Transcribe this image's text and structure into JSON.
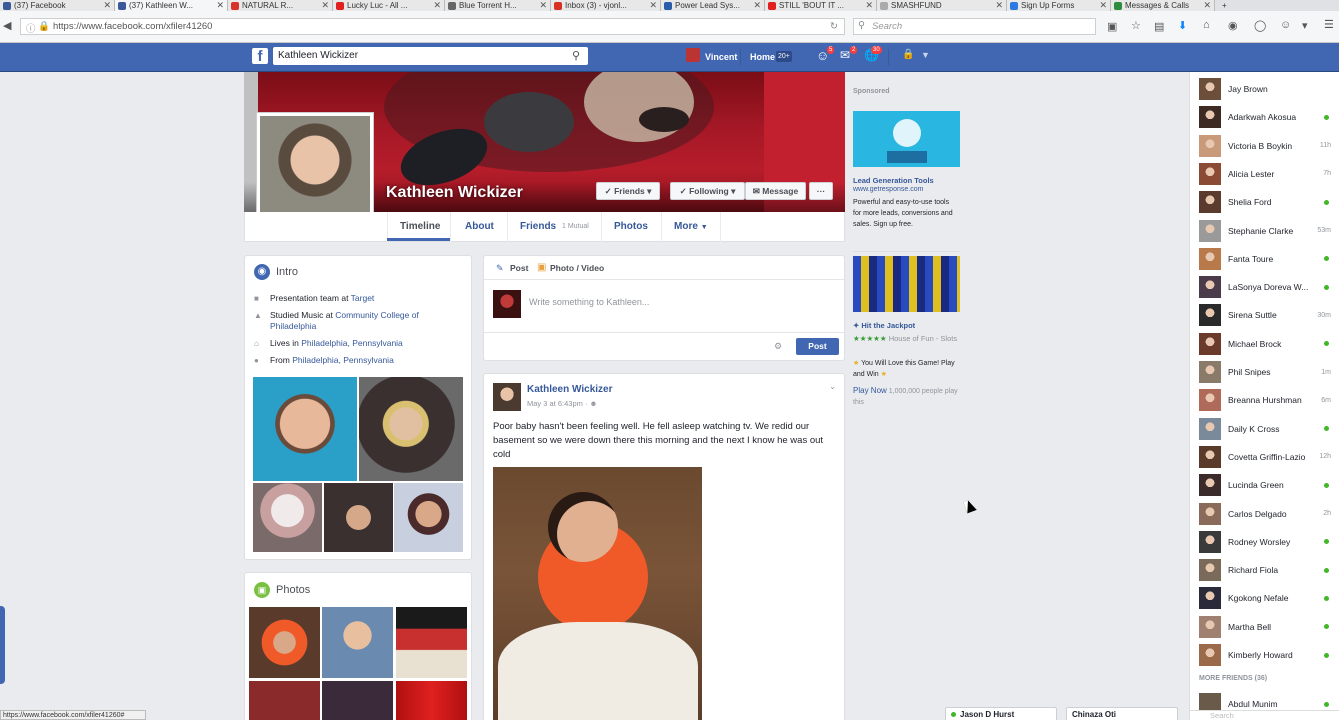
{
  "browser": {
    "tabs": [
      {
        "label": "(37) Facebook",
        "color": "#3b5998",
        "active": false
      },
      {
        "label": "(37) Kathleen W...",
        "color": "#3b5998",
        "active": true
      },
      {
        "label": "NATURAL R...",
        "color": "#d9302c",
        "active": false
      },
      {
        "label": "Lucky Luc - All ...",
        "color": "#e02020",
        "active": false
      },
      {
        "label": "Blue Torrent H...",
        "color": "#666",
        "active": false
      },
      {
        "label": "Inbox (3) - vjonl...",
        "color": "#d93025",
        "active": false
      },
      {
        "label": "Power Lead Sys...",
        "color": "#2a5caa",
        "active": false
      },
      {
        "label": "STILL 'BOUT IT ...",
        "color": "#e02020",
        "active": false
      },
      {
        "label": "SMASHFUND",
        "color": "#aaa",
        "active": false
      },
      {
        "label": "Sign Up Forms",
        "color": "#2a7ae2",
        "active": false
      },
      {
        "label": "Messages & Calls",
        "color": "#2f8c3c",
        "active": false
      }
    ],
    "url": "https://www.facebook.com/xfiler41260",
    "search_placeholder": "Search",
    "status_url": "https://www.facebook.com/xfiler41260#"
  },
  "header": {
    "search_value": "Kathleen Wickizer",
    "user_name": "Vincent",
    "home_label": "Home",
    "home_count": "20+",
    "friend_req_count": "5",
    "messages_count": "2",
    "notif_count": "30"
  },
  "profile": {
    "name": "Kathleen Wickizer",
    "friends_btn": "Friends",
    "following_btn": "Following",
    "message_btn": "Message",
    "more_btn": "···",
    "tabs": {
      "timeline": "Timeline",
      "about": "About",
      "friends": "Friends",
      "mutual": "1 Mutual",
      "photos": "Photos",
      "more": "More"
    }
  },
  "intro": {
    "title": "Intro",
    "work_pre": "Presentation team at ",
    "work_link": "Target",
    "study_pre": "Studied Music at ",
    "study_link": "Community College of Philadelphia",
    "lives_pre": "Lives in ",
    "lives_link": "Philadelphia, Pennsylvania",
    "from_pre": "From ",
    "from_link": "Philadelphia, Pennsylvania"
  },
  "photos_card": {
    "title": "Photos"
  },
  "composer": {
    "post_tab": "Post",
    "photo_tab": "Photo / Video",
    "placeholder": "Write something to Kathleen...",
    "post_button": "Post"
  },
  "post": {
    "author": "Kathleen Wickizer",
    "time": "May 3 at 6:43pm",
    "text": "Poor baby hasn't been feeling well. He fell asleep watching tv. We redid our basement so we were down there this morning and the next I know he was out cold"
  },
  "ads": {
    "sponsored": "Sponsored",
    "ad1_title": "Lead Generation Tools",
    "ad1_url": "www.getresponse.com",
    "ad1_text": "Powerful and easy-to-use tools for more leads, conversions and sales. Sign up free.",
    "ad2_title": "Hit the Jackpot",
    "ad2_stars": "★★★★★",
    "ad2_sub": "House of Fun - Slots",
    "ad2_text": "You Will Love this Game! Play and Win",
    "ad2_cta": "Play Now",
    "ad2_count": "1,000,000 people play this"
  },
  "chat": {
    "friends": [
      {
        "name": "Jay Brown",
        "status": "",
        "online": false,
        "color": "#6b4f3a"
      },
      {
        "name": "Adarkwah Akosua",
        "status": "",
        "online": true,
        "color": "#3d2a22"
      },
      {
        "name": "Victoria B Boykin",
        "status": "11h",
        "online": false,
        "color": "#c99a7a"
      },
      {
        "name": "Alicia Lester",
        "status": "7h",
        "online": false,
        "color": "#8a4a34"
      },
      {
        "name": "Shelia Ford",
        "status": "",
        "online": true,
        "color": "#5b3b2d"
      },
      {
        "name": "Stephanie Clarke",
        "status": "53m",
        "online": false,
        "color": "#9a9a9a"
      },
      {
        "name": "Fanta Toure",
        "status": "",
        "online": true,
        "color": "#b87a4a"
      },
      {
        "name": "LaSonya Doreva W...",
        "status": "",
        "online": true,
        "color": "#4a3a4a"
      },
      {
        "name": "Sirena Suttle",
        "status": "30m",
        "online": false,
        "color": "#2a2a2a"
      },
      {
        "name": "Michael Brock",
        "status": "",
        "online": true,
        "color": "#6a3a2a"
      },
      {
        "name": "Phil Snipes",
        "status": "1m",
        "online": false,
        "color": "#8a7a6a"
      },
      {
        "name": "Breanna Hurshman",
        "status": "6m",
        "online": false,
        "color": "#b06a5a"
      },
      {
        "name": "Daily K Cross",
        "status": "",
        "online": true,
        "color": "#7a8a9a"
      },
      {
        "name": "Covetta Griffin-Lazio",
        "status": "12h",
        "online": false,
        "color": "#5a3a2a"
      },
      {
        "name": "Lucinda Green",
        "status": "",
        "online": true,
        "color": "#3a2a2a"
      },
      {
        "name": "Carlos Delgado",
        "status": "2h",
        "online": false,
        "color": "#8a6a5a"
      },
      {
        "name": "Rodney Worsley",
        "status": "",
        "online": true,
        "color": "#3a3a3a"
      },
      {
        "name": "Richard Fiola",
        "status": "",
        "online": true,
        "color": "#7a6a5a"
      },
      {
        "name": "Kgokong Nefale",
        "status": "",
        "online": true,
        "color": "#2a2a3a"
      },
      {
        "name": "Martha Bell",
        "status": "",
        "online": true,
        "color": "#a08070"
      },
      {
        "name": "Kimberly Howard",
        "status": "",
        "online": true,
        "color": "#9a6a4a"
      }
    ],
    "more_friends": "MORE FRIENDS (36)",
    "extra": {
      "name": "Abdul Munim",
      "online": true
    },
    "search_placeholder": "Search",
    "bottom_tabs": [
      {
        "name": "Jason D Hurst",
        "online": true
      },
      {
        "name": "Chinaza Oti",
        "online": false
      }
    ]
  },
  "colors": {
    "fb_blue": "#4267b2",
    "link": "#365899",
    "online": "#42b72a"
  }
}
